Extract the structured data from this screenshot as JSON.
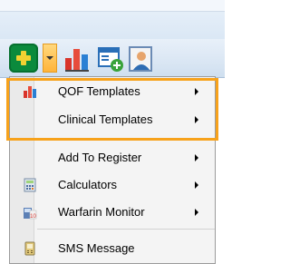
{
  "toolbar": {
    "add_icon": "plus-icon",
    "dropdown_icon": "chevron-down-icon",
    "tools": [
      "bar-chart-icon",
      "template-add-icon",
      "patient-icon"
    ]
  },
  "menu": {
    "items": [
      {
        "label": "QOF Templates",
        "icon": "bar-chart-icon",
        "submenu": true
      },
      {
        "label": "Clinical Templates",
        "icon": "",
        "submenu": true
      },
      {
        "label": "Add To Register",
        "icon": "",
        "submenu": true
      },
      {
        "label": "Calculators",
        "icon": "calculator-icon",
        "submenu": true
      },
      {
        "label": "Warfarin Monitor",
        "icon": "warfarin-icon",
        "submenu": true
      },
      {
        "label": "SMS Message",
        "icon": "sms-icon",
        "submenu": false
      }
    ]
  },
  "colors": {
    "highlight": "#f7a21b",
    "add_button": "#0b8a3c"
  }
}
